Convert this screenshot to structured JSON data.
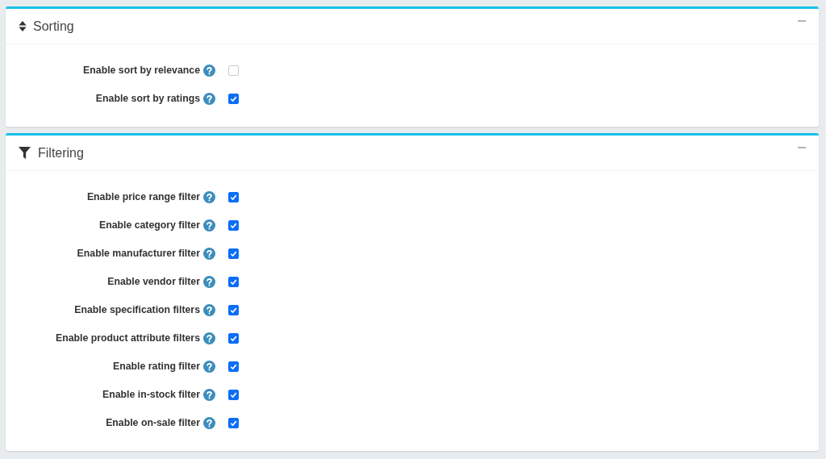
{
  "panels": [
    {
      "title": "Sorting",
      "kind": "sort",
      "expanded": true,
      "settings": [
        {
          "label": "Enable sort by relevance",
          "checked": false
        },
        {
          "label": "Enable sort by ratings",
          "checked": true
        }
      ]
    },
    {
      "title": "Filtering",
      "kind": "filter",
      "expanded": true,
      "settings": [
        {
          "label": "Enable price range filter",
          "checked": true
        },
        {
          "label": "Enable category filter",
          "checked": true
        },
        {
          "label": "Enable manufacturer filter",
          "checked": true
        },
        {
          "label": "Enable vendor filter",
          "checked": true
        },
        {
          "label": "Enable specification filters",
          "checked": true
        },
        {
          "label": "Enable product attribute filters",
          "checked": true
        },
        {
          "label": "Enable rating filter",
          "checked": true
        },
        {
          "label": "Enable in-stock filter",
          "checked": true
        },
        {
          "label": "Enable on-sale filter",
          "checked": true
        }
      ]
    }
  ]
}
